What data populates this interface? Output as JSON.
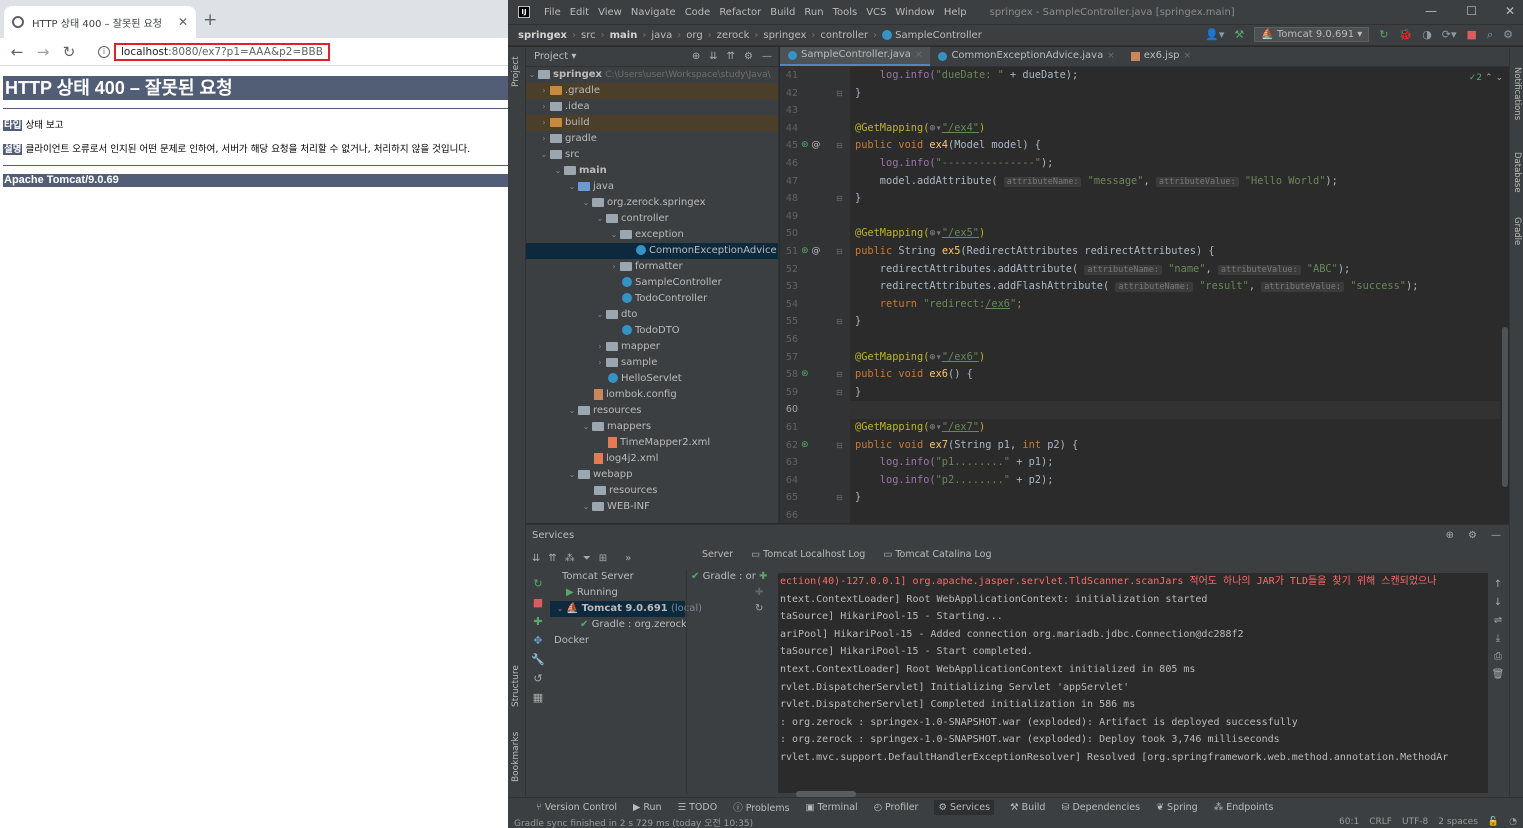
{
  "browser": {
    "tab_title": "HTTP 상태 400 – 잘못된 요청",
    "url_host": "localhost",
    "url_rest": ":8080/ex7?p1=AAA&p2=BBB",
    "page": {
      "title": "HTTP 상태 400 – 잘못된 요청",
      "type_label": "타입",
      "type_text": "상태 보고",
      "desc_label": "설명",
      "desc_text": "클라이언트 오류로서 인지된 어떤 문제로 인하여, 서버가 해당 요청을 처리할 수 없거나, 처리하지 않을 것입니다.",
      "server": "Apache Tomcat/9.0.69"
    }
  },
  "ide": {
    "menu": [
      "File",
      "Edit",
      "View",
      "Navigate",
      "Code",
      "Refactor",
      "Build",
      "Run",
      "Tools",
      "VCS",
      "Window",
      "Help"
    ],
    "window_title": "springex - SampleController.java [springex.main]",
    "breadcrumb": [
      "springex",
      "src",
      "main",
      "java",
      "org",
      "zerock",
      "springex",
      "controller",
      "SampleController"
    ],
    "run_config": "Tomcat 9.0.691",
    "project_label": "Project",
    "project_tree": [
      {
        "label": "springex",
        "extra": "C:\\Users\\user\\Workspace\\study\\Java\\"
      },
      {
        "label": ".gradle"
      },
      {
        "label": ".idea"
      },
      {
        "label": "build"
      },
      {
        "label": "gradle"
      },
      {
        "label": "src"
      },
      {
        "label": "main"
      },
      {
        "label": "java"
      },
      {
        "label": "org.zerock.springex"
      },
      {
        "label": "controller"
      },
      {
        "label": "exception"
      },
      {
        "label": "CommonExceptionAdvice"
      },
      {
        "label": "formatter"
      },
      {
        "label": "SampleController"
      },
      {
        "label": "TodoController"
      },
      {
        "label": "dto"
      },
      {
        "label": "TodoDTO"
      },
      {
        "label": "mapper"
      },
      {
        "label": "sample"
      },
      {
        "label": "HelloServlet"
      },
      {
        "label": "lombok.config"
      },
      {
        "label": "resources"
      },
      {
        "label": "mappers"
      },
      {
        "label": "TimeMapper2.xml"
      },
      {
        "label": "log4j2.xml"
      },
      {
        "label": "webapp"
      },
      {
        "label": "resources"
      },
      {
        "label": "WEB-INF"
      }
    ],
    "editor_tabs": [
      "SampleController.java",
      "CommonExceptionAdvice.java",
      "ex6.jsp"
    ],
    "inspection_count": "✓2",
    "line_numbers": [
      "41",
      "42",
      "43",
      "44",
      "45",
      "46",
      "47",
      "48",
      "49",
      "50",
      "51",
      "52",
      "53",
      "54",
      "55",
      "56",
      "57",
      "58",
      "59",
      "60",
      "61",
      "62",
      "63",
      "64",
      "65",
      "66"
    ],
    "code": {
      "l41a": "    log.info(",
      "l41b": "\"dueDate: \"",
      "l41c": " + dueDate);",
      "l42": "}",
      "l44a": "@GetMapping(",
      "l44b": "\"/ex4\"",
      "l44c": ")",
      "l45a": "public void ",
      "l45b": "ex4",
      "l45c": "(Model model) {",
      "l46a": "    log.info(",
      "l46b": "\"---------------\"",
      "l46c": ");",
      "l47a": "    model.addAttribute( ",
      "l47h1": "attributeName:",
      "l47b": " \"message\"",
      ",": ",",
      "l47h2": "attributeValue:",
      "l47c": " \"Hello World\"",
      "l47d": ");",
      "l48": "}",
      "l50a": "@GetMapping(",
      "l50b": "\"/ex5\"",
      "l50c": ")",
      "l51a": "public ",
      "l51b": "String ",
      "l51c": "ex5",
      "l51d": "(RedirectAttributes redirectAttributes) {",
      "l52a": "    redirectAttributes.addAttribute( ",
      "l52h1": "attributeName:",
      "l52b": " \"name\"",
      "l52h2": "attributeValue:",
      "l52c": " \"ABC\"",
      "l52d": ");",
      "l53a": "    redirectAttributes.addFlashAttribute( ",
      "l53h1": "attributeName:",
      "l53b": " \"result\"",
      "l53h2": "attributeValue:",
      "l53c": " \"success\"",
      "l53d": ");",
      "l54a": "    return ",
      "l54b": "\"redirect:",
      "l54c": "/ex6",
      "l54d": "\"",
      "l54e": ";",
      "l55": "}",
      "l57a": "@GetMapping(",
      "l57b": "\"/ex6\"",
      "l57c": ")",
      "l58a": "public void ",
      "l58b": "ex6",
      "l58c": "() {",
      "l59": "}",
      "l61a": "@GetMapping(",
      "l61b": "\"/ex7\"",
      "l61c": ")",
      "l62a": "public void ",
      "l62b": "ex7",
      "l62c": "(String p1, ",
      "l62d": "int ",
      "l62e": "p2) {",
      "l63a": "    log.info(",
      "l63b": "\"p1........\"",
      "l63c": " + p1);",
      "l64a": "    log.info(",
      "l64b": "\"p2........\"",
      "l64c": " + p2);",
      "l65": "}"
    },
    "services": {
      "title": "Services",
      "tabs": [
        "Server",
        "Tomcat Localhost Log",
        "Tomcat Catalina Log"
      ],
      "tree": [
        "Tomcat Server",
        "Running",
        "Tomcat 9.0.691",
        "(local)",
        "Gradle : org.zerock",
        "Docker"
      ],
      "deploy": "Gradle : or",
      "console": [
        "ection(40)-127.0.0.1] org.apache.jasper.servlet.TldScanner.scanJars 적어도 하나의 JAR가 TLD들을 찾기 위해 스캔되었으나",
        "ntext.ContextLoader] Root WebApplicationContext: initialization started",
        "taSource] HikariPool-15 - Starting...",
        "ariPool] HikariPool-15 - Added connection org.mariadb.jdbc.Connection@dc288f2",
        "taSource] HikariPool-15 - Start completed.",
        "ntext.ContextLoader] Root WebApplicationContext initialized in 805 ms",
        "rvlet.DispatcherServlet] Initializing Servlet 'appServlet'",
        "rvlet.DispatcherServlet] Completed initialization in 586 ms",
        ": org.zerock : springex-1.0-SNAPSHOT.war (exploded): Artifact is deployed successfully",
        ": org.zerock : springex-1.0-SNAPSHOT.war (exploded): Deploy took 3,746 milliseconds",
        "rvlet.mvc.support.DefaultHandlerExceptionResolver] Resolved [org.springframework.web.method.annotation.MethodAr"
      ]
    },
    "bottom_tools": [
      "Version Control",
      "Run",
      "TODO",
      "Problems",
      "Terminal",
      "Profiler",
      "Services",
      "Build",
      "Dependencies",
      "Spring",
      "Endpoints"
    ],
    "side_labels": {
      "project": "Project",
      "structure": "Structure",
      "bookmarks": "Bookmarks",
      "notifications": "Notifications",
      "database": "Database",
      "gradle": "Gradle"
    },
    "status": {
      "message": "Gradle sync finished in 2 s 729 ms (today 오전 10:35)",
      "position": "60:1",
      "line_sep": "CRLF",
      "encoding": "UTF-8",
      "indent": "2 spaces"
    }
  }
}
